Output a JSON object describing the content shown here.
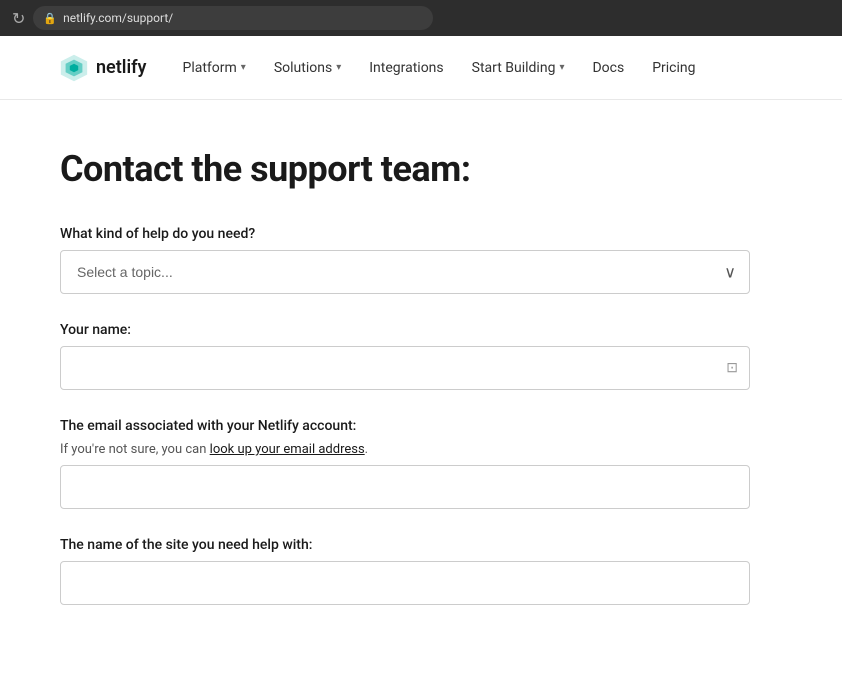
{
  "browser": {
    "url": "netlify.com/support/",
    "reload_icon": "↻"
  },
  "navbar": {
    "logo_text": "netlify",
    "links": [
      {
        "label": "Platform",
        "has_dropdown": true
      },
      {
        "label": "Solutions",
        "has_dropdown": true
      },
      {
        "label": "Integrations",
        "has_dropdown": false
      },
      {
        "label": "Start Building",
        "has_dropdown": true
      },
      {
        "label": "Docs",
        "has_dropdown": false
      },
      {
        "label": "Pricing",
        "has_dropdown": false
      }
    ]
  },
  "page": {
    "title": "Contact the support team:",
    "form": {
      "topic_label": "What kind of help do you need?",
      "topic_placeholder": "Select a topic...",
      "name_label": "Your name:",
      "name_placeholder": "",
      "email_label": "The email associated with your Netlify account:",
      "email_help_text": "If you're not sure, you can",
      "email_help_link": "look up your email address",
      "email_help_end": ".",
      "email_placeholder": "",
      "site_label": "The name of the site you need help with:",
      "site_placeholder": ""
    }
  },
  "icons": {
    "chevron_down": "∨",
    "lock": "🔒",
    "person": "👤"
  }
}
